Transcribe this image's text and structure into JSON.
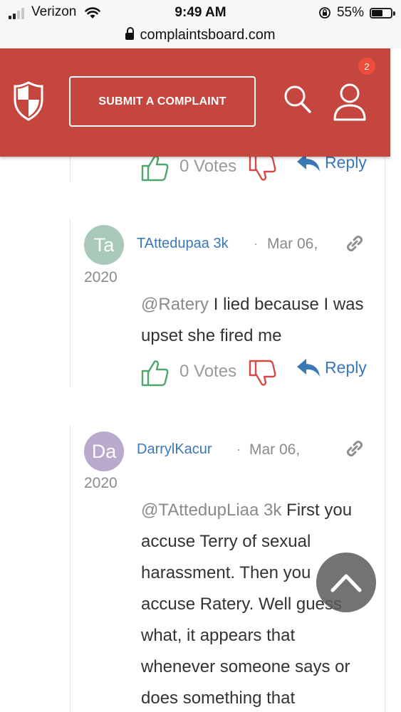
{
  "status_bar": {
    "carrier": "Verizon",
    "time": "9:49 AM",
    "battery_percent": "55%",
    "battery_level": 0.55
  },
  "browser": {
    "url": "complaintsboard.com"
  },
  "header": {
    "submit_label": "SUBMIT A COMPLAINT",
    "notification_count": "2",
    "brand_color": "#c4463e"
  },
  "prev_comment": {
    "votes": "0 Votes",
    "reply_label": "Reply"
  },
  "comments": [
    {
      "initials": "Ta",
      "avatar_color": "#a9c9b9",
      "author": "TAttedupaa 3k",
      "separator": "·",
      "date": "Mar 06,",
      "year": "2020",
      "mention": "@Ratery",
      "text": " I lied because I was upset she fired me",
      "votes": "0 Votes",
      "reply_label": "Reply"
    },
    {
      "initials": "Da",
      "avatar_color": "#b9a9cc",
      "author": "DarrylKacur",
      "separator": "·",
      "date": "Mar 06,",
      "year": "2020",
      "mention": "@TAttedupLiaa 3k",
      "text": " First you accuse Terry of sexual harassment. Then you accuse Ratery. Well guess what, it appears that whenever someone says or does something that"
    }
  ],
  "icons": {
    "shield": "shield-logo-icon",
    "search": "search-icon",
    "user": "user-icon",
    "thumbs_up": "thumbs-up-icon",
    "thumbs_down": "thumbs-down-icon",
    "reply": "reply-arrow-icon",
    "link": "link-icon",
    "scroll_top": "chevron-up-icon"
  }
}
